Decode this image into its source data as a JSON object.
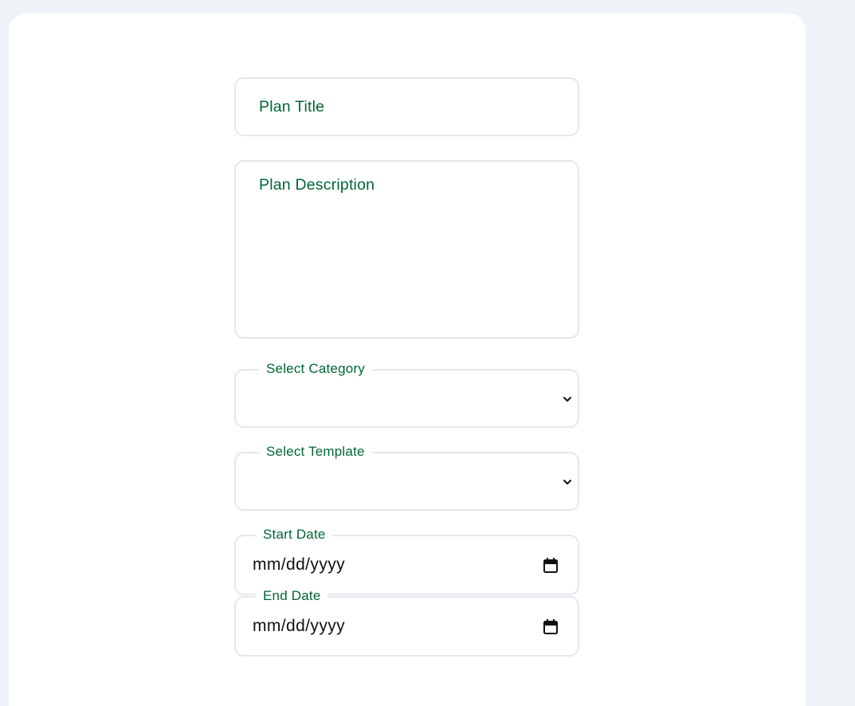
{
  "form": {
    "plan_title_placeholder": "Plan Title",
    "plan_description_placeholder": "Plan Description",
    "category_label": "Select Category",
    "template_label": "Select Template",
    "start_date_label": "Start Date",
    "start_date_value": "mm/dd/yyyy",
    "end_date_label": "End Date",
    "end_date_value": "mm/dd/yyyy"
  },
  "icons": {
    "select_arrow": "chevron-down-icon",
    "date_picker": "calendar-icon"
  },
  "colors": {
    "label_green": "#006633",
    "border": "#e4e7ee",
    "page_background": "#eff3f8",
    "card_background": "#ffffff"
  }
}
